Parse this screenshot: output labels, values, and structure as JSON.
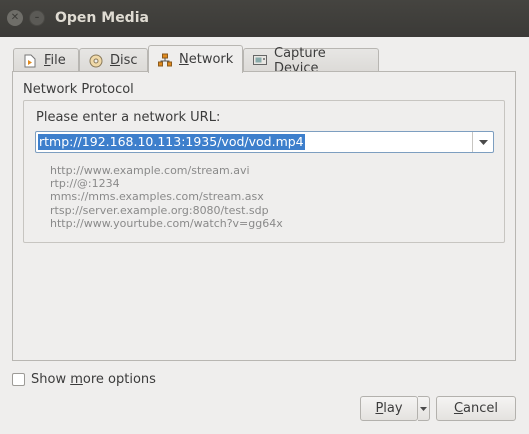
{
  "window": {
    "title": "Open Media"
  },
  "tabs": [
    {
      "label": "File",
      "mnemonic": "F",
      "rest": "ile",
      "icon": "file-icon"
    },
    {
      "label": "Disc",
      "mnemonic": "D",
      "rest": "isc",
      "icon": "disc-icon"
    },
    {
      "label": "Network",
      "mnemonic": "N",
      "rest": "etwork",
      "icon": "network-icon",
      "active": true
    },
    {
      "label": "Capture Device",
      "pre": "Capture ",
      "mnemonic": "D",
      "rest": "evice",
      "icon": "capture-device-icon"
    }
  ],
  "network": {
    "group_title": "Network Protocol",
    "url_label": "Please enter a network URL:",
    "url_value": "rtmp://192.168.10.113:1935/vod/vod.mp4",
    "examples": [
      "http://www.example.com/stream.avi",
      "rtp://@:1234",
      "mms://mms.examples.com/stream.asx",
      "rtsp://server.example.org:8080/test.sdp",
      "http://www.yourtube.com/watch?v=gg64x"
    ]
  },
  "options": {
    "pre": "Show ",
    "mnemonic": "m",
    "rest": "ore options",
    "label": "Show more options",
    "checked": false
  },
  "buttons": {
    "play": {
      "mnemonic": "P",
      "rest": "lay",
      "label": "Play"
    },
    "cancel": {
      "mnemonic": "C",
      "rest": "ancel",
      "label": "Cancel"
    }
  },
  "colors": {
    "titlebar": "#3b3a37",
    "selection": "#3d7fcc",
    "focus_border": "#7d9ec0"
  }
}
